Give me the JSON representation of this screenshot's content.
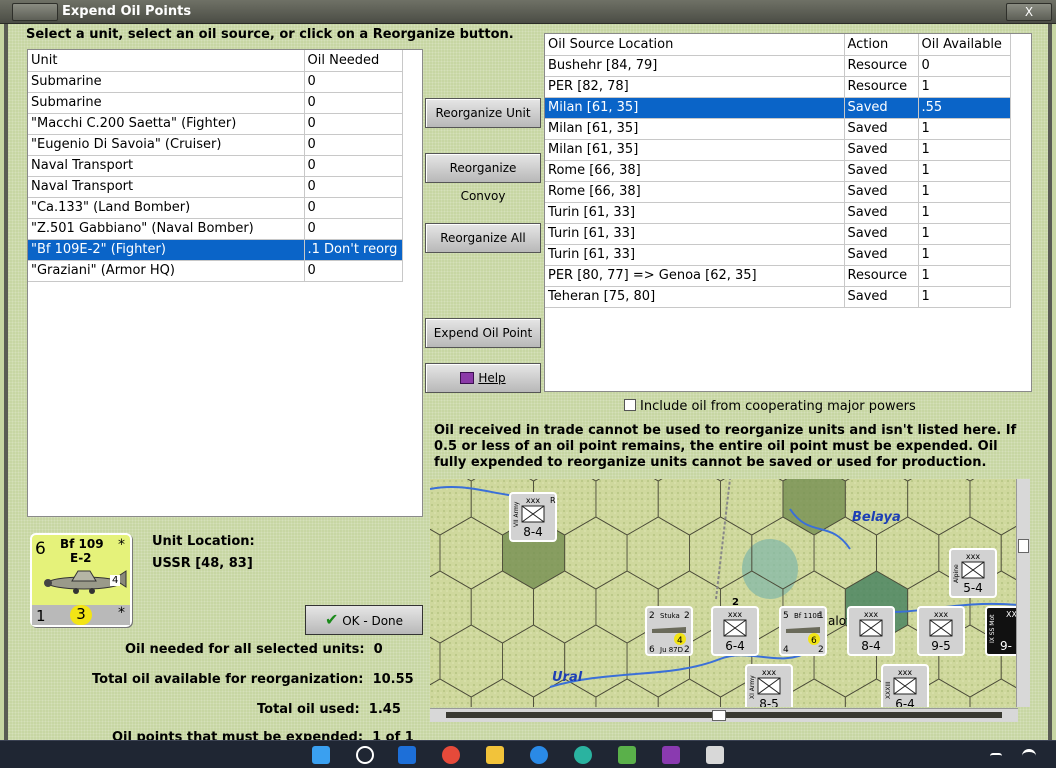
{
  "window": {
    "title": "Expend Oil Points",
    "close_glyph": "X"
  },
  "instruction": "Select a unit, select an oil source, or click on a Reorganize button.",
  "units_table": {
    "headers": [
      "Unit",
      "Oil Needed"
    ],
    "rows": [
      {
        "unit": "Submarine",
        "oil": "0"
      },
      {
        "unit": "Submarine",
        "oil": "0"
      },
      {
        "unit": "\"Macchi C.200 Saetta\" (Fighter)",
        "oil": "0"
      },
      {
        "unit": "\"Eugenio Di Savoia\" (Cruiser)",
        "oil": "0"
      },
      {
        "unit": "Naval Transport",
        "oil": "0"
      },
      {
        "unit": "Naval Transport",
        "oil": "0"
      },
      {
        "unit": "\"Ca.133\" (Land Bomber)",
        "oil": "0"
      },
      {
        "unit": "\"Z.501 Gabbiano\" (Naval Bomber)",
        "oil": "0"
      },
      {
        "unit": "\"Bf 109E-2\" (Fighter)",
        "oil": ".1 Don't reorg"
      },
      {
        "unit": "\"Graziani\" (Armor HQ)",
        "oil": "0"
      }
    ],
    "selected_index": 8
  },
  "oil_table": {
    "headers": [
      "Oil Source Location",
      "Action",
      "Oil Available"
    ],
    "rows": [
      {
        "location": "Bushehr [84, 79]",
        "action": "Resource",
        "available": "0"
      },
      {
        "location": "PER [82, 78]",
        "action": "Resource",
        "available": "1"
      },
      {
        "location": "Milan [61, 35]",
        "action": "Saved",
        "available": ".55"
      },
      {
        "location": "Milan [61, 35]",
        "action": "Saved",
        "available": "1"
      },
      {
        "location": "Milan [61, 35]",
        "action": "Saved",
        "available": "1"
      },
      {
        "location": "Rome [66, 38]",
        "action": "Saved",
        "available": "1"
      },
      {
        "location": "Rome [66, 38]",
        "action": "Saved",
        "available": "1"
      },
      {
        "location": "Turin [61, 33]",
        "action": "Saved",
        "available": "1"
      },
      {
        "location": "Turin [61, 33]",
        "action": "Saved",
        "available": "1"
      },
      {
        "location": "Turin [61, 33]",
        "action": "Saved",
        "available": "1"
      },
      {
        "location": "PER [80, 77] => Genoa [62, 35]",
        "action": "Resource",
        "available": "1"
      },
      {
        "location": "Teheran [75, 80]",
        "action": "Saved",
        "available": "1"
      }
    ],
    "selected_index": 2
  },
  "buttons": {
    "reorganize_unit": "Reorganize Unit",
    "reorganize_convoy": "Reorganize Convoy",
    "reorganize_all": "Reorganize All",
    "expend_oil_point": "Expend Oil Point",
    "help": "Help",
    "ok_done": "OK - Done"
  },
  "include_oil_label": "Include oil from cooperating major powers",
  "note": "Oil received in trade cannot be used to reorganize units and isn't listed here.  If 0.5 or less of an oil point remains, the entire oil point must be expended.   Oil fully expended to reorganize units cannot be saved or used for production.",
  "unit_counter": {
    "top_left": "6",
    "name_line1": "Bf 109",
    "name_line2": "E-2",
    "star": "*",
    "bottom_left": "1",
    "bottom_center": "3",
    "bottom_right": "*",
    "plane_code": "4"
  },
  "unit_location": {
    "label": "Unit Location:",
    "value": "USSR [48, 83]"
  },
  "stats": {
    "oil_needed_label": "Oil needed for all selected units:",
    "oil_needed_value": "0",
    "total_available_label": "Total oil available for reorganization:",
    "total_available_value": "10.55",
    "total_used_label": "Total oil used:",
    "total_used_value": "1.45",
    "must_expend_label": "Oil points that must be expended:",
    "must_expend_value": "1 of 1"
  },
  "map": {
    "labels": {
      "belaya": "Belaya",
      "ural": "Ural",
      "kalov": "alov"
    },
    "counters": [
      {
        "top": "xxx",
        "side": "R",
        "bottom": "8-4",
        "rot": "VII Army"
      },
      {
        "top": "xxx",
        "bottom": "6-4",
        "rot": ""
      },
      {
        "top": "xxx",
        "bottom": "8-4",
        "rot": ""
      },
      {
        "top": "xxx",
        "bottom": "9-5",
        "rot": ""
      },
      {
        "top": "xxx",
        "bottom": "5-4",
        "rot": "Alpine"
      },
      {
        "top": "xxx",
        "bottom": "8-5",
        "rot": "XI Army"
      },
      {
        "top": "xxx",
        "bottom": "6-4",
        "rot": "XXXIII"
      }
    ],
    "air1": {
      "tl": "2",
      "tr": "2",
      "name": "Stuka",
      "bl": "6",
      "code": "Ju 87D",
      "br": "2",
      "badge": "4"
    },
    "air2": {
      "tl": "5",
      "name": "Bf 110E",
      "tr": "1",
      "bl": "4",
      "badge": "6",
      "br": "2"
    },
    "stack_count": "2",
    "right_edge_counter": {
      "top": "XX",
      "bottom": "9-",
      "rot": "IX SS Mot"
    }
  },
  "colors": {
    "selection": "#0a64c8",
    "dialog_bg": "#c7d6a3",
    "counter_yellow": "#e5f27a",
    "water": "#3a6fd8"
  }
}
